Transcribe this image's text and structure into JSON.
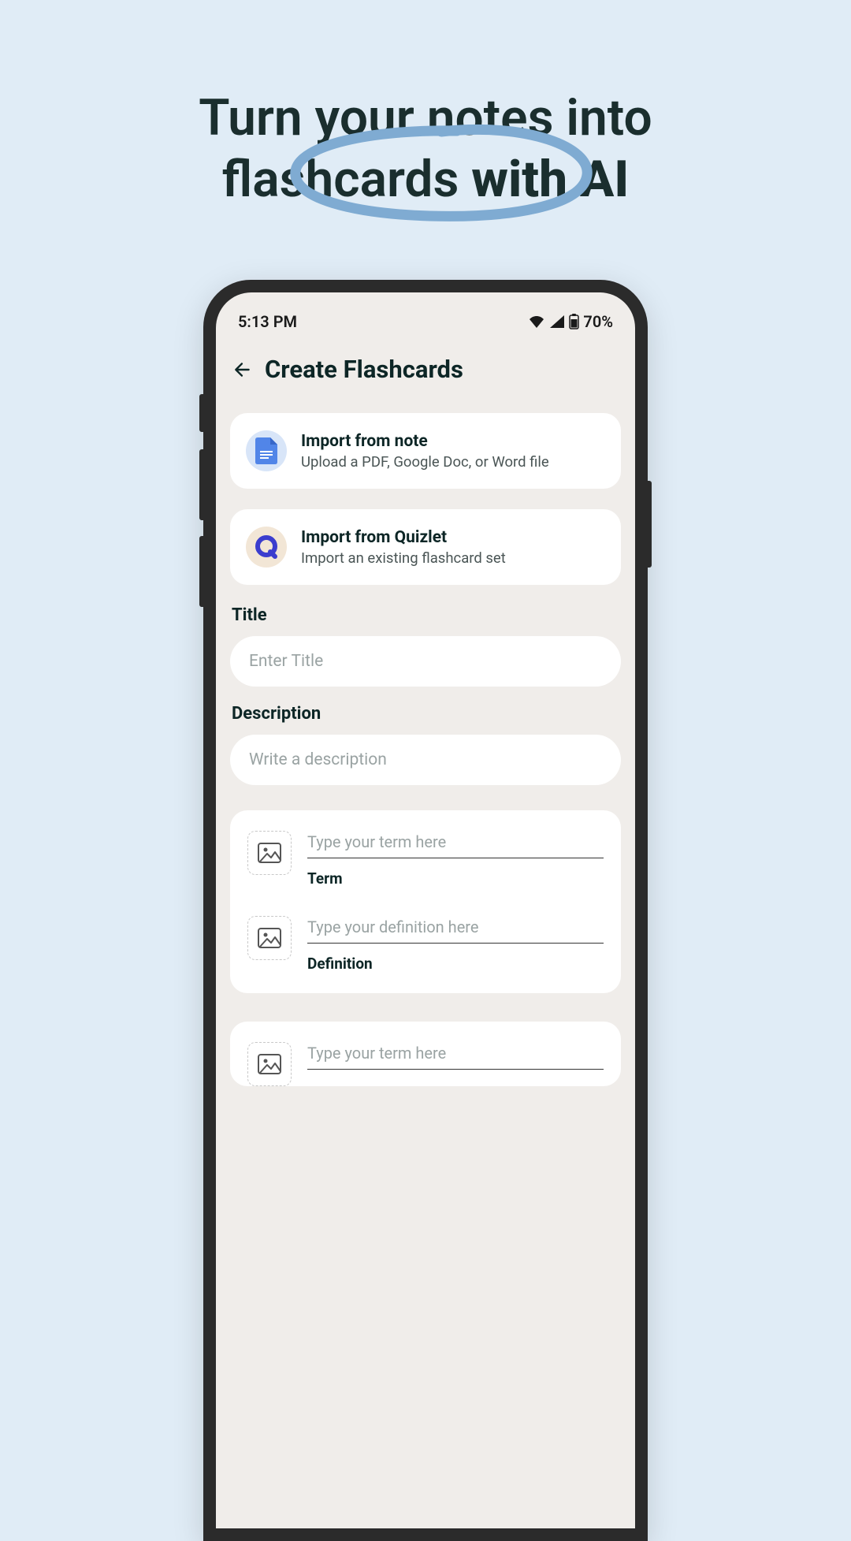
{
  "marketing": {
    "line1": "Turn your notes into",
    "line2a": "flashcards ",
    "line2b": "with AI"
  },
  "status": {
    "time": "5:13 PM",
    "battery": "70%"
  },
  "header": {
    "title": "Create Flashcards"
  },
  "import": {
    "note": {
      "title": "Import from note",
      "sub": "Upload a PDF, Google Doc, or Word file"
    },
    "quizlet": {
      "title": "Import from Quizlet",
      "sub": "Import an existing flashcard set"
    }
  },
  "fields": {
    "title_label": "Title",
    "title_placeholder": "Enter Title",
    "desc_label": "Description",
    "desc_placeholder": "Write a description"
  },
  "card": {
    "term_placeholder": "Type your term here",
    "term_label": "Term",
    "def_placeholder": "Type your definition here",
    "def_label": "Definition"
  }
}
